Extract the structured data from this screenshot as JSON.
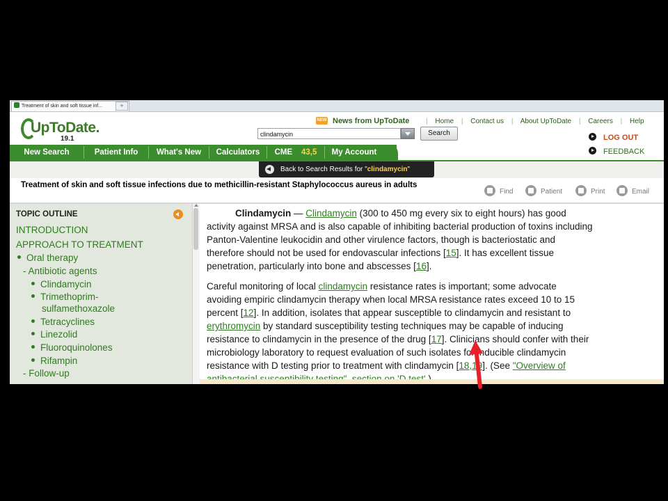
{
  "browser": {
    "tab_title": "Treatment of skin and soft tissue inf...",
    "new_tab_label": "+"
  },
  "header": {
    "logo_text": "UpToDate.",
    "logo_version": "19.1",
    "news_badge": "NEW",
    "news_label": "News from UpToDate",
    "top_links": [
      "Home",
      "Contact us",
      "About UpToDate",
      "Careers",
      "Help"
    ],
    "search_value": "clindamycin",
    "search_button": "Search",
    "logout": "LOG OUT",
    "feedback": "FEEDBACK"
  },
  "nav": {
    "items": [
      "New Search",
      "Patient Info",
      "What's New",
      "Calculators",
      "CME",
      "My Account"
    ],
    "cme_value": "43,5"
  },
  "back": {
    "prefix": "Back to Search Results for \"",
    "term": "clindamycin",
    "suffix": "\""
  },
  "topic": {
    "title": "Treatment of skin and soft tissue infections due to methicillin-resistant Staphylococcus aureus in adults",
    "tools": [
      "Find",
      "Patient",
      "Print",
      "Email"
    ]
  },
  "outline": {
    "heading": "TOPIC OUTLINE",
    "items": [
      {
        "label": "INTRODUCTION",
        "level": 0
      },
      {
        "label": "APPROACH TO TREATMENT",
        "level": 0
      },
      {
        "label": "Oral therapy",
        "level": 1
      },
      {
        "label": "- Antibiotic agents",
        "level": 2
      },
      {
        "label": "Clindamycin",
        "level": 3
      },
      {
        "label": "Trimethoprim-",
        "level": 3
      },
      {
        "label": "sulfamethoxazole",
        "level": 4
      },
      {
        "label": "Tetracyclines",
        "level": 3
      },
      {
        "label": "Linezolid",
        "level": 3
      },
      {
        "label": "Fluoroquinolones",
        "level": 3
      },
      {
        "label": "Rifampin",
        "level": 3
      },
      {
        "label": "- Follow-up",
        "level": 2
      }
    ]
  },
  "content": {
    "p1": {
      "bold": "Clindamycin",
      "dash": " — ",
      "link": "Clindamycin",
      "line1": " (300 to 450 mg every six to eight hours) has good",
      "line2": "activity against MRSA and is also capable of inhibiting bacterial production of toxins including",
      "line3": "Panton-Valentine leukocidin and other virulence factors, though is bacteriostatic and",
      "line4a": "therefore should not be used for endovascular infections [",
      "ref15": "15",
      "line4b": "]. It has excellent tissue",
      "line5a": "penetration, particularly into bone and abscesses [",
      "ref16": "16",
      "line5b": "]."
    },
    "p2": {
      "l1a": "Careful monitoring of local ",
      "l1link": "clindamycin",
      "l1b": " resistance rates is important; some advocate",
      "l2": "avoiding empiric clindamycin therapy when local MRSA resistance rates exceed 10 to 15",
      "l3a": "percent [",
      "ref12": "12",
      "l3b": "]. In addition, isolates that appear susceptible to clindamycin and resistant to",
      "l4link": "erythromycin",
      "l4b": " by standard susceptibility testing techniques may be capable of inducing",
      "l5a": "resistance to clindamycin in the presence of the drug [",
      "ref17": "17",
      "l5b": "]. Clinicians should confer with their",
      "l6": "microbiology laboratory to request evaluation of such isolates for inducible clindamycin",
      "l7a": "resistance with D testing prior to treatment with clindamycin [",
      "ref1819": "18,19",
      "l7b": "]. (See ",
      "l7link": "\"Overview of",
      "l8link": "antibacterial susceptibility testing\", section on 'D test'",
      "l8b": ".)"
    }
  },
  "annotation": {
    "arrow_color": "#e8202a"
  }
}
